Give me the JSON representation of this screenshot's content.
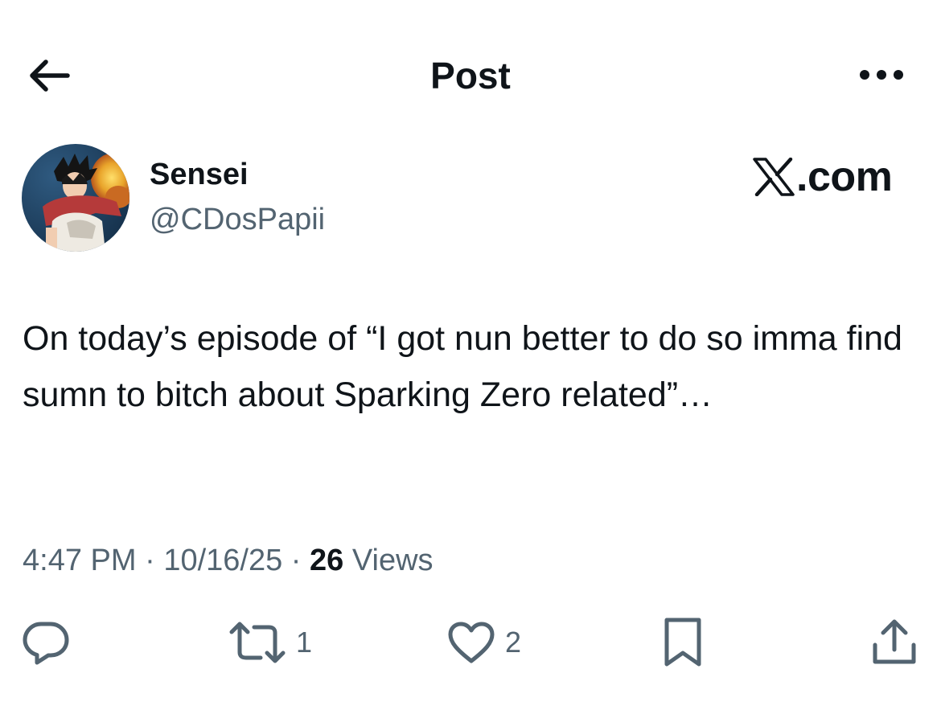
{
  "header": {
    "title": "Post"
  },
  "author": {
    "name": "Sensei",
    "handle": "@CDosPapii"
  },
  "watermark": {
    "text": ".com"
  },
  "post": {
    "text": "On today’s episode of “I got nun better to do so imma find sumn to bitch about Sparking Zero related”…"
  },
  "meta": {
    "time": "4:47 PM",
    "separator": " · ",
    "date": "10/16/25",
    "views_count": "26",
    "views_label": " Views"
  },
  "actions": {
    "retweet_count": "1",
    "like_count": "2"
  },
  "icons": {
    "back": "arrow-left-icon",
    "more": "more-horizontal-icon",
    "reply": "reply-icon",
    "retweet": "retweet-icon",
    "like": "heart-icon",
    "bookmark": "bookmark-icon",
    "share": "share-icon"
  },
  "colors": {
    "text_primary": "#0f1419",
    "text_secondary": "#536471",
    "background": "#ffffff"
  }
}
